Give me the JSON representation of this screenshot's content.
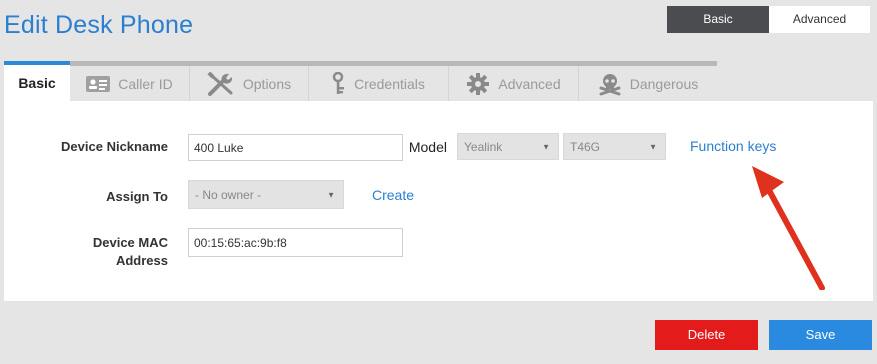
{
  "page": {
    "title": "Edit Desk Phone"
  },
  "view_toggle": {
    "basic": "Basic",
    "advanced": "Advanced"
  },
  "tabs": [
    {
      "label": "Basic",
      "icon": "none"
    },
    {
      "label": "Caller ID",
      "icon": "id-card-icon"
    },
    {
      "label": "Options",
      "icon": "tools-icon"
    },
    {
      "label": "Credentials",
      "icon": "key-icon"
    },
    {
      "label": "Advanced",
      "icon": "gear-icon"
    },
    {
      "label": "Dangerous",
      "icon": "skull-crossbones-icon"
    }
  ],
  "form": {
    "nickname": {
      "label": "Device Nickname",
      "value": "400 Luke"
    },
    "model": {
      "label": "Model",
      "brand": "Yealink",
      "model": "T46G"
    },
    "function_keys": "Function keys",
    "assign_to": {
      "label": "Assign To",
      "value": "- No owner -",
      "create": "Create"
    },
    "mac": {
      "label": "Device MAC Address",
      "value": "00:15:65:ac:9b:f8"
    }
  },
  "actions": {
    "delete": "Delete",
    "save": "Save"
  },
  "colors": {
    "accent": "#2a7fd0",
    "danger": "#e41b1b",
    "save": "#2a8ae0",
    "arrow": "#e0301e"
  }
}
